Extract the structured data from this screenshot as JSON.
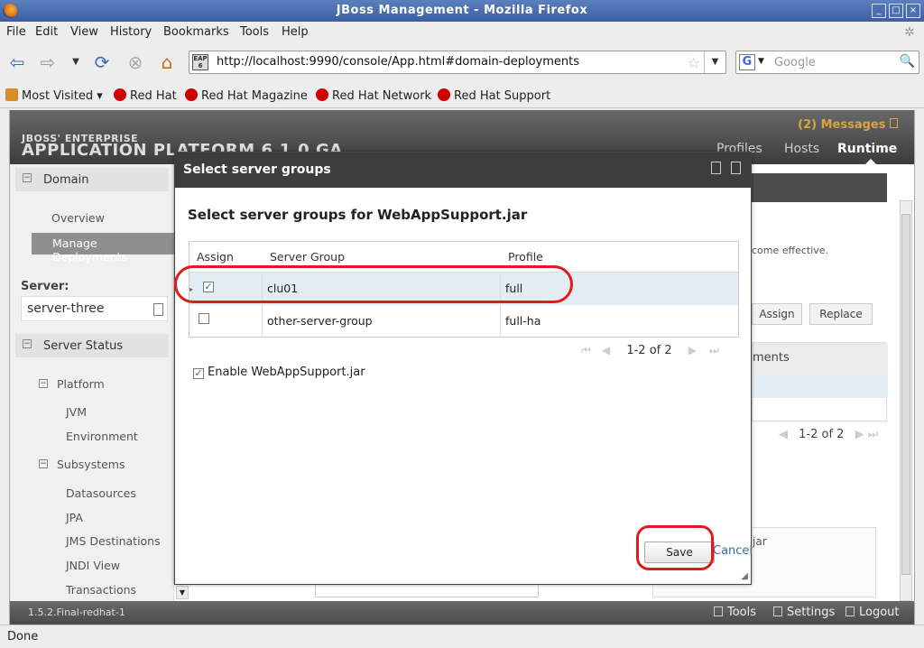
{
  "window": {
    "title": "JBoss Management - Mozilla Firefox"
  },
  "menu": [
    "File",
    "Edit",
    "View",
    "History",
    "Bookmarks",
    "Tools",
    "Help"
  ],
  "nav": {
    "url": "http://localhost:9990/console/App.html#domain-deployments",
    "search_placeholder": "Google",
    "site_badge": "EAP 6"
  },
  "bookmarks": [
    "Most Visited",
    "Red Hat",
    "Red Hat Magazine",
    "Red Hat Network",
    "Red Hat Support"
  ],
  "app": {
    "brand_top": "JBOSS' ENTERPRISE",
    "brand_main": "APPLICATION PLATFORM 6.1.0 GA",
    "messages": "(2) Messages",
    "tabs": [
      "Profiles",
      "Hosts",
      "Runtime"
    ],
    "active_tab": "Runtime"
  },
  "sidebar": {
    "domain": "Domain",
    "overview": "Overview",
    "manage_deployments": "Manage Deployments",
    "server_label": "Server:",
    "server_value": "server-three",
    "server_status": "Server Status",
    "platform": "Platform",
    "jvm": "JVM",
    "environment": "Environment",
    "subsystems": "Subsystems",
    "datasources": "Datasources",
    "jpa": "JPA",
    "jms": "JMS Destinations",
    "jndi": "JNDI View",
    "transactions": "Transactions"
  },
  "background": {
    "effective_text": "come effective.",
    "assign": "Assign",
    "replace": "Replace",
    "deployments_header": "ments",
    "pager": "1-2 of 2",
    "jar_text": "jar"
  },
  "footer": {
    "version": "1.5.2.Final-redhat-1",
    "tools": "Tools",
    "settings": "Settings",
    "logout": "Logout"
  },
  "modal": {
    "title": "Select server groups",
    "subtitle": "Select server groups for WebAppSupport.jar",
    "columns": [
      "Assign",
      "Server Group",
      "Profile"
    ],
    "rows": [
      {
        "checked": true,
        "group": "clu01",
        "profile": "full"
      },
      {
        "checked": false,
        "group": "other-server-group",
        "profile": "full-ha"
      }
    ],
    "pager": "1-2 of 2",
    "enable_label": "Enable WebAppSupport.jar",
    "enable_checked": true,
    "save": "Save",
    "cancel": "Cancel"
  },
  "status": "Done",
  "colors": {
    "annotation_ring": "#e01b1b",
    "header_dark": "#3d3d3d",
    "messages_accent": "#d7a53f",
    "selected_row": "#e3edf3"
  }
}
